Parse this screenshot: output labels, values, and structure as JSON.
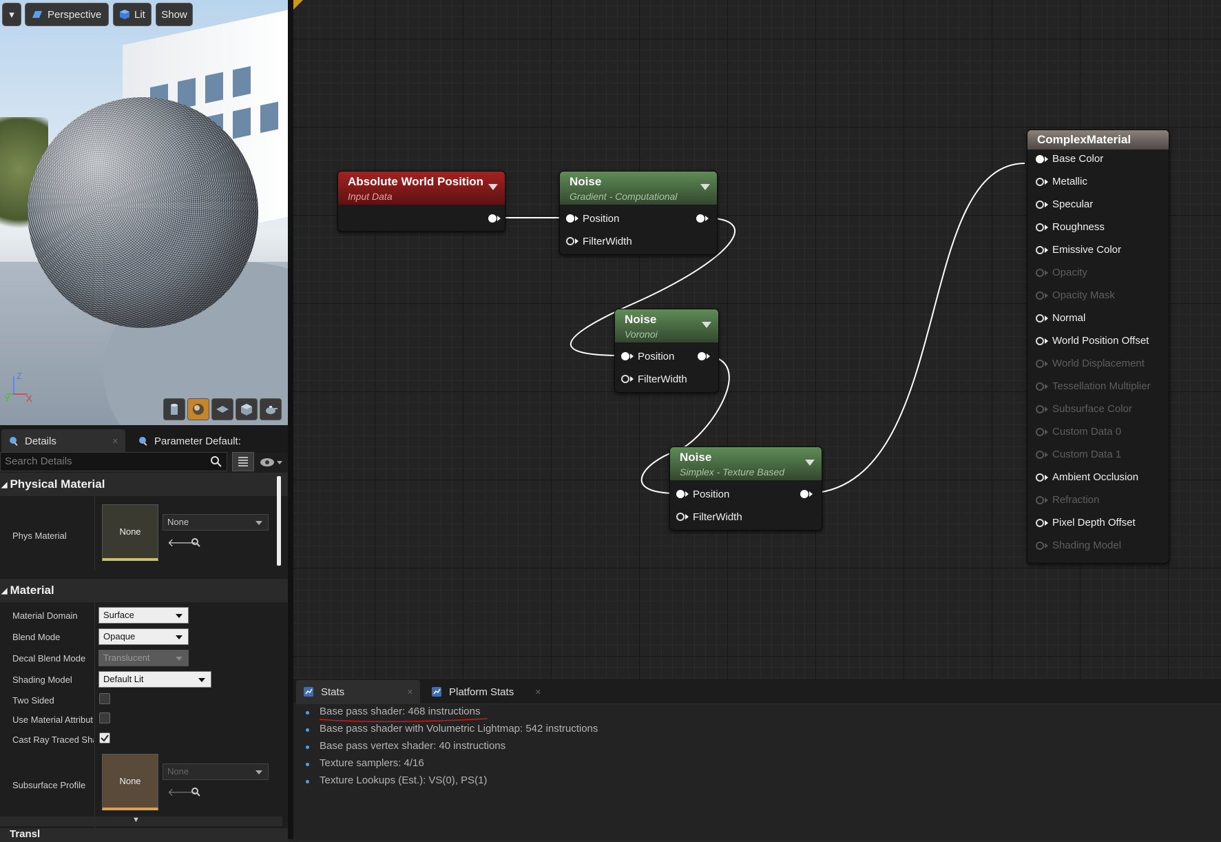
{
  "viewport": {
    "menu_caret": "▾",
    "perspective_label": "Perspective",
    "lit_label": "Lit",
    "show_label": "Show",
    "axis_z": "Z",
    "axis_x": "X",
    "axis_y": "Y",
    "preview_tools": [
      "cylinder-icon",
      "sphere-icon",
      "plane-icon",
      "cube-icon",
      "teapot-icon"
    ],
    "active_tool": "sphere-icon"
  },
  "tabs": {
    "details": "Details",
    "parameter_defaults": "Parameter Default:"
  },
  "search": {
    "placeholder": "Search Details"
  },
  "physical_material": {
    "header": "Physical Material",
    "phys_material_label": "Phys Material",
    "thumb_label": "None",
    "combo_value": "None"
  },
  "material": {
    "header": "Material",
    "rows": [
      {
        "label": "Material Domain",
        "value": "Surface"
      },
      {
        "label": "Blend Mode",
        "value": "Opaque"
      },
      {
        "label": "Decal Blend Mode",
        "value": "Translucent"
      },
      {
        "label": "Shading Model",
        "value": "Default Lit"
      },
      {
        "label": "Two Sided",
        "checked": false
      },
      {
        "label": "Use Material Attribut",
        "checked": false
      },
      {
        "label": "Cast Ray Traced Sha",
        "checked": true
      },
      {
        "label": "Subsurface Profile",
        "thumb": "None",
        "combo": "None"
      }
    ],
    "next_header_partial": "Transl"
  },
  "graph": {
    "nodes": {
      "awp": {
        "title": "Absolute World Position",
        "subtitle": "Input Data"
      },
      "noise1": {
        "title": "Noise",
        "subtitle": "Gradient - Computational",
        "inputs": [
          "Position",
          "FilterWidth"
        ]
      },
      "noise2": {
        "title": "Noise",
        "subtitle": "Voronoi",
        "inputs": [
          "Position",
          "FilterWidth"
        ]
      },
      "noise3": {
        "title": "Noise",
        "subtitle": "Simplex - Texture Based",
        "inputs": [
          "Position",
          "FilterWidth"
        ]
      },
      "result": {
        "title": "ComplexMaterial",
        "pins": [
          {
            "label": "Base Color",
            "state": "connected"
          },
          {
            "label": "Metallic",
            "state": "active"
          },
          {
            "label": "Specular",
            "state": "active"
          },
          {
            "label": "Roughness",
            "state": "active"
          },
          {
            "label": "Emissive Color",
            "state": "active"
          },
          {
            "label": "Opacity",
            "state": "disabled"
          },
          {
            "label": "Opacity Mask",
            "state": "disabled"
          },
          {
            "label": "Normal",
            "state": "active"
          },
          {
            "label": "World Position Offset",
            "state": "active"
          },
          {
            "label": "World Displacement",
            "state": "disabled"
          },
          {
            "label": "Tessellation Multiplier",
            "state": "disabled"
          },
          {
            "label": "Subsurface Color",
            "state": "disabled"
          },
          {
            "label": "Custom Data 0",
            "state": "disabled"
          },
          {
            "label": "Custom Data 1",
            "state": "disabled"
          },
          {
            "label": "Ambient Occlusion",
            "state": "active"
          },
          {
            "label": "Refraction",
            "state": "disabled"
          },
          {
            "label": "Pixel Depth Offset",
            "state": "active"
          },
          {
            "label": "Shading Model",
            "state": "disabled"
          }
        ]
      }
    }
  },
  "stats": {
    "tab_stats": "Stats",
    "tab_platform": "Platform Stats",
    "lines": [
      "Base pass shader: 468 instructions",
      "Base pass shader with Volumetric Lightmap: 542 instructions",
      "Base pass vertex shader: 40 instructions",
      "Texture samplers: 4/16",
      "Texture Lookups (Est.): VS(0), PS(1)"
    ]
  },
  "colors": {
    "input_node": "#8e1c1c",
    "noise_node": "#4f7a4a",
    "result_node": "#6e6660",
    "accent_orange": "#c5852a",
    "annotation_red": "#d01818"
  }
}
